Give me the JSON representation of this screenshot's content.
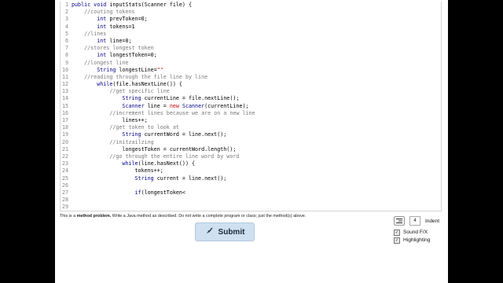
{
  "code_lines": [
    {
      "n": "1",
      "segs": [
        [
          "k",
          "public void "
        ],
        [
          "t",
          "inputStats(Scanner file) {"
        ]
      ]
    },
    {
      "n": "2",
      "segs": [
        [
          "t",
          "    "
        ],
        [
          "c",
          "//couting tokens"
        ]
      ]
    },
    {
      "n": "3",
      "segs": [
        [
          "t",
          "        "
        ],
        [
          "k",
          "int "
        ],
        [
          "t",
          "prevToken="
        ],
        [
          "t",
          "0"
        ],
        [
          "t",
          ";"
        ]
      ]
    },
    {
      "n": "4",
      "segs": [
        [
          "t",
          "        "
        ],
        [
          "k",
          "int "
        ],
        [
          "t",
          "tokens=1"
        ]
      ]
    },
    {
      "n": "5",
      "segs": [
        [
          "t",
          "    "
        ],
        [
          "c",
          "//lines"
        ]
      ]
    },
    {
      "n": "6",
      "segs": [
        [
          "t",
          "        "
        ],
        [
          "k",
          "int "
        ],
        [
          "t",
          "line=0;"
        ]
      ]
    },
    {
      "n": "7",
      "segs": [
        [
          "t",
          "    "
        ],
        [
          "c",
          "//stores longest token"
        ]
      ]
    },
    {
      "n": "8",
      "segs": [
        [
          "t",
          "        "
        ],
        [
          "k",
          "int "
        ],
        [
          "t",
          "longestToken=0;"
        ]
      ]
    },
    {
      "n": "9",
      "segs": [
        [
          "t",
          "    "
        ],
        [
          "c",
          "//longest line"
        ]
      ]
    },
    {
      "n": "10",
      "segs": [
        [
          "t",
          "        "
        ],
        [
          "k",
          "String "
        ],
        [
          "t",
          "longestLine="
        ],
        [
          "n",
          "\"\""
        ]
      ]
    },
    {
      "n": "11",
      "segs": [
        [
          "t",
          "    "
        ],
        [
          "c",
          "//reading through the file line by line"
        ]
      ]
    },
    {
      "n": "12",
      "segs": [
        [
          "t",
          "        "
        ],
        [
          "k",
          "while"
        ],
        [
          "t",
          "(file.hasNextLine()) {"
        ]
      ]
    },
    {
      "n": "13",
      "segs": [
        [
          "t",
          "            "
        ],
        [
          "c",
          "//get specific line"
        ]
      ]
    },
    {
      "n": "14",
      "segs": [
        [
          "t",
          "                "
        ],
        [
          "k",
          "String "
        ],
        [
          "t",
          "currentLine = file.nextLine();"
        ]
      ]
    },
    {
      "n": "15",
      "segs": [
        [
          "t",
          "                "
        ],
        [
          "k",
          "Scanner "
        ],
        [
          "t",
          "line = "
        ],
        [
          "n",
          "new "
        ],
        [
          "k",
          "Scanner"
        ],
        [
          "t",
          "(currentLine);"
        ]
      ]
    },
    {
      "n": "16",
      "segs": [
        [
          "t",
          "            "
        ],
        [
          "c",
          "//increment lines because we are on a new line"
        ]
      ]
    },
    {
      "n": "17",
      "segs": [
        [
          "t",
          "                lines++;"
        ]
      ]
    },
    {
      "n": "18",
      "segs": [
        [
          "t",
          "            "
        ],
        [
          "c",
          "//get token to look at"
        ]
      ]
    },
    {
      "n": "19",
      "segs": [
        [
          "t",
          "                "
        ],
        [
          "k",
          "String "
        ],
        [
          "t",
          "currentWord = line.next();"
        ]
      ]
    },
    {
      "n": "20",
      "segs": [
        [
          "t",
          "            "
        ],
        [
          "c",
          "//initzailzing"
        ]
      ]
    },
    {
      "n": "21",
      "segs": [
        [
          "t",
          "                longestToken = currentWord.length();"
        ]
      ]
    },
    {
      "n": "22",
      "segs": [
        [
          "t",
          "            "
        ],
        [
          "c",
          "//go through the entire line word by word"
        ]
      ]
    },
    {
      "n": "23",
      "segs": [
        [
          "t",
          "                "
        ],
        [
          "k",
          "while"
        ],
        [
          "t",
          "(line.hasNext()) {"
        ]
      ]
    },
    {
      "n": "24",
      "segs": [
        [
          "t",
          "                    tokens++;"
        ]
      ]
    },
    {
      "n": "25",
      "segs": [
        [
          "t",
          "                    "
        ],
        [
          "k",
          "String "
        ],
        [
          "t",
          "current = line.next();"
        ]
      ]
    },
    {
      "n": "26",
      "segs": [
        [
          "t",
          ""
        ]
      ]
    },
    {
      "n": "27",
      "segs": [
        [
          "t",
          "                    "
        ],
        [
          "k",
          "if"
        ],
        [
          "t",
          "(longestToken<"
        ]
      ]
    },
    {
      "n": "28",
      "segs": [
        [
          "t",
          ""
        ]
      ]
    },
    {
      "n": "29",
      "segs": [
        [
          "t",
          ""
        ]
      ]
    }
  ],
  "problem_note": {
    "prefix": "This is a ",
    "bold": "method problem.",
    "suffix": " Write a Java method as described. Do not write a complete program or class; just the method(s) above."
  },
  "submit_label": "Submit",
  "indent": {
    "value": "4",
    "label": "Indent"
  },
  "options": [
    {
      "label": "Sound F/X",
      "checked": true
    },
    {
      "label": "Highlighting",
      "checked": true
    }
  ],
  "colors": {
    "keyword": "#00008b",
    "comment": "#7a7a7a",
    "new_keyword": "#c00000",
    "submit_bg": "#cfe0f0"
  },
  "icons": {
    "submit": "rocket-icon",
    "indent": "indent-icon",
    "checkbox": "checkmark-icon"
  }
}
